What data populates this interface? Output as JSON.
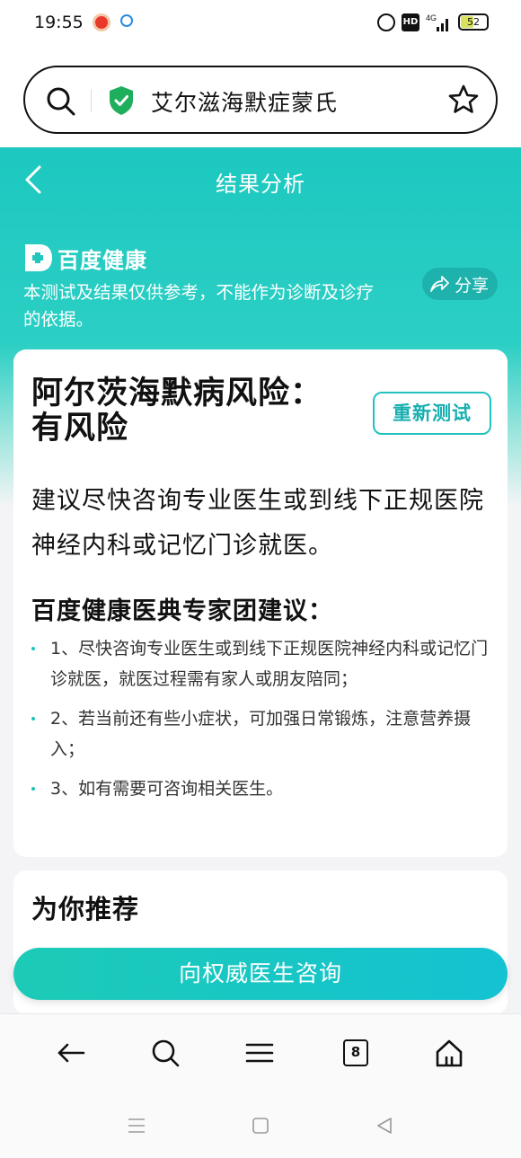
{
  "status_bar": {
    "time": "19:55",
    "network": "4G",
    "battery": "52",
    "battery_level_percent": 52,
    "icons": [
      "app-notification-icon",
      "search-app-icon",
      "alarm-icon",
      "hd-icon",
      "signal-icon",
      "battery-icon"
    ]
  },
  "search": {
    "query": "艾尔滋海默症蒙氏",
    "icons": [
      "search-icon",
      "shield-check-icon",
      "star-icon"
    ]
  },
  "header": {
    "title": "结果分析",
    "brand": "百度健康",
    "disclaimer": "本测试及结果仅供参考，不能作为诊断及诊疗的依据。",
    "share_label": "分享"
  },
  "result": {
    "title": "阿尔茨海默病风险：有风险",
    "retest_label": "重新测试",
    "advice": "建议尽快咨询专业医生或到线下正规医院神经内科或记忆门诊就医。",
    "expert_heading": "百度健康医典专家团建议：",
    "suggestions": [
      "1、尽快咨询专业医生或到线下正规医院神经内科或记忆门诊就医，就医过程需有家人或朋友陪同；",
      "2、若当前还有些小症状，可加强日常锻炼，注意营养摄入；",
      "3、如有需要可咨询相关医生。"
    ]
  },
  "recommend": {
    "title": "为你推荐"
  },
  "consult_button_label": "向权威医生咨询",
  "toolbar": {
    "tab_count": "8",
    "icons": [
      "back-arrow-icon",
      "search-icon",
      "menu-icon",
      "tabs-icon",
      "home-icon"
    ]
  },
  "colors": {
    "accent": "#1cc8c0",
    "button_gradient_start": "#1ccbb6",
    "button_gradient_end": "#14c2d2"
  }
}
